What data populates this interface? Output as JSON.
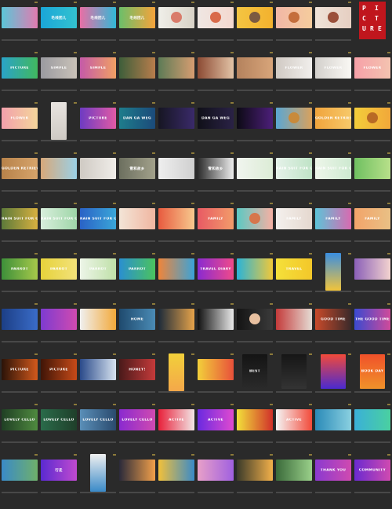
{
  "app": {
    "view": "file-browser-thumbnail-grid"
  },
  "thumbnails": [
    {
      "r": 0,
      "c": 0,
      "bg": "linear-gradient(90deg,#5bc6d8,#e17bb0)",
      "text": ""
    },
    {
      "r": 0,
      "c": 1,
      "bg": "linear-gradient(90deg,#1aa6d8,#33c2cf)",
      "text": "毛线团儿"
    },
    {
      "r": 0,
      "c": 2,
      "bg": "linear-gradient(90deg,#e86fa5,#32b9d6)",
      "text": "毛线团儿"
    },
    {
      "r": 0,
      "c": 3,
      "bg": "linear-gradient(90deg,#6bbf6a,#f6a33b)",
      "text": "毛线团儿"
    },
    {
      "r": 0,
      "c": 4,
      "bg": "linear-gradient(90deg,#f0efe9,#d9d3c7)",
      "text": "",
      "photo": "#d97b6a"
    },
    {
      "r": 0,
      "c": 5,
      "bg": "linear-gradient(90deg,#efe7e3,#f4d8cf)",
      "text": "",
      "photo": "#d96a4a"
    },
    {
      "r": 0,
      "c": 6,
      "bg": "linear-gradient(90deg,#f4c542,#f3b12e)",
      "text": "",
      "photo": "#7b5a41"
    },
    {
      "r": 0,
      "c": 7,
      "bg": "linear-gradient(90deg,#f2b7a6,#f5cc9d)",
      "text": "",
      "photo": "#c46e3c"
    },
    {
      "r": 0,
      "c": 8,
      "bg": "linear-gradient(90deg,#efe3d8,#e6cfc2)",
      "text": "",
      "photo": "#9a4f3a"
    },
    {
      "r": 1,
      "c": 0,
      "bg": "linear-gradient(90deg,#2aa3c8,#41b85f)",
      "text": "PICTURE"
    },
    {
      "r": 1,
      "c": 1,
      "bg": "linear-gradient(90deg,#9a9aa0,#c9c2b8)",
      "text": "SIMPLE"
    },
    {
      "r": 1,
      "c": 2,
      "bg": "linear-gradient(90deg,#c45aa8,#f0a064)",
      "text": "SIMPLE"
    },
    {
      "r": 1,
      "c": 3,
      "bg": "linear-gradient(90deg,#3d5e3a,#b87d4c)",
      "text": ""
    },
    {
      "r": 1,
      "c": 4,
      "bg": "linear-gradient(90deg,#5d7b56,#d79d71)",
      "text": ""
    },
    {
      "r": 1,
      "c": 5,
      "bg": "linear-gradient(90deg,#8c4a33,#e3c4a7)",
      "text": ""
    },
    {
      "r": 1,
      "c": 6,
      "bg": "linear-gradient(90deg,#b4825d,#d8a57a)",
      "text": ""
    },
    {
      "r": 1,
      "c": 7,
      "bg": "linear-gradient(90deg,#d0c9c3,#f1efec)",
      "text": "FLOWER"
    },
    {
      "r": 1,
      "c": 8,
      "bg": "linear-gradient(90deg,#d3d0cc,#faf8f4)",
      "text": "FLOWER"
    },
    {
      "r": 1,
      "c": 9,
      "bg": "linear-gradient(90deg,#f6a0a8,#f4c3b0)",
      "text": "FLOWER"
    },
    {
      "r": 2,
      "c": 0,
      "bg": "linear-gradient(90deg,#f2a0ac,#f4d59b)",
      "text": "FLOWER"
    },
    {
      "r": 2,
      "c": 1,
      "type": "portrait",
      "bg": "linear-gradient(180deg,#e8e4e0,#cfcac4)",
      "text": ""
    },
    {
      "r": 2,
      "c": 2,
      "bg": "linear-gradient(90deg,#6d3bc2,#e25aa5)",
      "text": "PICTURE"
    },
    {
      "r": 2,
      "c": 3,
      "bg": "linear-gradient(90deg,#1e7d8c,#1b4a7a)",
      "text": "DAN GA WEG"
    },
    {
      "r": 2,
      "c": 4,
      "bg": "linear-gradient(90deg,#161622,#3a2a6a)",
      "text": ""
    },
    {
      "r": 2,
      "c": 5,
      "bg": "linear-gradient(90deg,#101018,#2a2246)",
      "text": "DAN GA WEG"
    },
    {
      "r": 2,
      "c": 6,
      "bg": "linear-gradient(90deg,#0c0a14,#4d1f7a)",
      "text": ""
    },
    {
      "r": 2,
      "c": 7,
      "bg": "linear-gradient(90deg,#5aa7d3,#d9a15d)",
      "text": "",
      "photo": "#c88a3b"
    },
    {
      "r": 2,
      "c": 8,
      "bg": "linear-gradient(90deg,#f0a43c,#f7c96a)",
      "text": "GOLDEN RETRIEVER"
    },
    {
      "r": 2,
      "c": 9,
      "bg": "linear-gradient(90deg,#f3cd3a,#f1a83a)",
      "text": "",
      "photo": "#b86a25"
    },
    {
      "r": 3,
      "c": 0,
      "bg": "linear-gradient(90deg,#b7824a,#d6a46b)",
      "text": "GOLDEN RETRIEVER"
    },
    {
      "r": 3,
      "c": 1,
      "bg": "linear-gradient(90deg,#d7a87a,#9bd0e6)",
      "text": ""
    },
    {
      "r": 3,
      "c": 2,
      "bg": "linear-gradient(90deg,#cfcac3,#f0ede9)",
      "text": ""
    },
    {
      "r": 3,
      "c": 3,
      "bg": "linear-gradient(90deg,#6c6f5f,#a2a18b)",
      "text": "雪和故乡"
    },
    {
      "r": 3,
      "c": 4,
      "bg": "linear-gradient(90deg,#efefef,#cfcfcf)",
      "text": ""
    },
    {
      "r": 3,
      "c": 5,
      "bg": "linear-gradient(90deg,#2b2b2b,#ededed)",
      "text": "雪和故乡"
    },
    {
      "r": 3,
      "c": 6,
      "bg": "linear-gradient(90deg,#f1f5ef,#dcecd6)",
      "text": ""
    },
    {
      "r": 3,
      "c": 7,
      "bg": "linear-gradient(90deg,#e6f2ea,#bfe3c6)",
      "text": "RAIN SUIT FOR OUTDOOR KIDS"
    },
    {
      "r": 3,
      "c": 8,
      "bg": "linear-gradient(90deg,#eef6ea,#cde9d0)",
      "text": "RAIN SUIT FOR OUTDOOR KIDS"
    },
    {
      "r": 3,
      "c": 9,
      "bg": "linear-gradient(90deg,#6fc061,#b8e08a)",
      "text": ""
    },
    {
      "r": 4,
      "c": 0,
      "bg": "linear-gradient(90deg,#5c7a3a,#d7b040)",
      "text": "RAIN SUIT FOR OUTDOOR KIDS"
    },
    {
      "r": 4,
      "c": 1,
      "bg": "linear-gradient(90deg,#d8eedc,#9fd6a8)",
      "text": "RAIN SUIT FOR OUTDOOR KIDS"
    },
    {
      "r": 4,
      "c": 2,
      "bg": "linear-gradient(90deg,#2a62c6,#3aa6d8)",
      "text": "RAIN SUIT FOR OUTDOOR KIDS"
    },
    {
      "r": 4,
      "c": 3,
      "bg": "linear-gradient(90deg,#f3e5d7,#f0b5a0)",
      "text": ""
    },
    {
      "r": 4,
      "c": 4,
      "bg": "linear-gradient(90deg,#e85b3f,#f7c98e)",
      "text": ""
    },
    {
      "r": 4,
      "c": 5,
      "bg": "linear-gradient(90deg,#e85a64,#f29c6a)",
      "text": "FAMILY"
    },
    {
      "r": 4,
      "c": 6,
      "bg": "linear-gradient(90deg,#5bc9c3,#f6b0a3)",
      "text": "",
      "photo": "#d6764c"
    },
    {
      "r": 4,
      "c": 7,
      "bg": "linear-gradient(90deg,#f4f0ed,#e5d8cf)",
      "text": "FAMILY"
    },
    {
      "r": 4,
      "c": 8,
      "bg": "linear-gradient(90deg,#5cc4d8,#d86ab0)",
      "text": "FAMILY"
    },
    {
      "r": 4,
      "c": 9,
      "bg": "linear-gradient(90deg,#f2a46a,#e9c085)",
      "text": "FAMILY"
    },
    {
      "r": 5,
      "c": 0,
      "bg": "linear-gradient(90deg,#3d8f3a,#a6c94a)",
      "text": "PARROT"
    },
    {
      "r": 5,
      "c": 1,
      "bg": "linear-gradient(90deg,#e6d23b,#f3e27a)",
      "text": "PARROT"
    },
    {
      "r": 5,
      "c": 2,
      "bg": "linear-gradient(90deg,#edf5e8,#bfe0a8)",
      "text": "PARROT"
    },
    {
      "r": 5,
      "c": 3,
      "bg": "linear-gradient(90deg,#2a8fd0,#4bc35e)",
      "text": "PARROT"
    },
    {
      "r": 5,
      "c": 4,
      "bg": "linear-gradient(90deg,#f0853a,#3aa3d8)",
      "text": ""
    },
    {
      "r": 5,
      "c": 5,
      "bg": "linear-gradient(90deg,#8a2ad0,#f04a8a)",
      "text": "TRAVEL DIARY"
    },
    {
      "r": 5,
      "c": 6,
      "bg": "linear-gradient(90deg,#2ab3d8,#f0c83a)",
      "text": ""
    },
    {
      "r": 5,
      "c": 7,
      "bg": "linear-gradient(90deg,#f5e03a,#f3c72a)",
      "text": "TRAVEL"
    },
    {
      "r": 5,
      "c": 8,
      "type": "portrait",
      "bg": "linear-gradient(180deg,#3a8ee0,#f2c43a)",
      "text": ""
    },
    {
      "r": 5,
      "c": 9,
      "bg": "linear-gradient(90deg,#8a5fb8,#f3d3cf)",
      "text": ""
    },
    {
      "r": 6,
      "c": 0,
      "bg": "linear-gradient(90deg,#1c3f86,#3a6cc8)",
      "text": ""
    },
    {
      "r": 6,
      "c": 1,
      "bg": "linear-gradient(90deg,#7d3bd0,#d04ab0)",
      "text": ""
    },
    {
      "r": 6,
      "c": 2,
      "bg": "linear-gradient(90deg,#f0f0f0,#f2a93a)",
      "text": ""
    },
    {
      "r": 6,
      "c": 3,
      "bg": "linear-gradient(90deg,#1f4a6e,#4a8bb5)",
      "text": "HOME"
    },
    {
      "r": 6,
      "c": 4,
      "bg": "linear-gradient(90deg,#1d2b3a,#e6a34a)",
      "text": ""
    },
    {
      "r": 6,
      "c": 5,
      "bg": "linear-gradient(90deg,#111111,#e9e9e9)",
      "text": ""
    },
    {
      "r": 6,
      "c": 6,
      "bg": "linear-gradient(90deg,#141414,#3a3a3a)",
      "text": "",
      "photo": "#e8c0a0"
    },
    {
      "r": 6,
      "c": 7,
      "bg": "linear-gradient(90deg,#c43a3a,#e5dcd4)",
      "text": ""
    },
    {
      "r": 6,
      "c": 8,
      "bg": "linear-gradient(90deg,#c94a2a,#3a2a2a)",
      "text": "GOOD TIME"
    },
    {
      "r": 6,
      "c": 9,
      "bg": "linear-gradient(90deg,#3a4ad0,#d04a9a)",
      "text": "THE GOOD TIME"
    },
    {
      "r": 7,
      "c": 0,
      "bg": "linear-gradient(90deg,#2b1308,#d2591c)",
      "text": "PICTURE"
    },
    {
      "r": 7,
      "c": 1,
      "bg": "linear-gradient(90deg,#401507,#c64a18)",
      "text": "PICTURE"
    },
    {
      "r": 7,
      "c": 2,
      "bg": "linear-gradient(90deg,#2a4a8a,#d7e3f0)",
      "text": ""
    },
    {
      "r": 7,
      "c": 3,
      "bg": "linear-gradient(90deg,#4a1a1a,#c43a3a)",
      "text": "HONEY!"
    },
    {
      "r": 7,
      "c": 4,
      "type": "portrait",
      "bg": "linear-gradient(180deg,#f2d03a,#f4a84a)",
      "text": ""
    },
    {
      "r": 7,
      "c": 5,
      "bg": "linear-gradient(90deg,#f2d03a,#e8503a)",
      "text": ""
    },
    {
      "r": 7,
      "c": 6,
      "type": "poster",
      "bg": "linear-gradient(180deg,#141414,#2a2a2a)",
      "text": "BEST"
    },
    {
      "r": 7,
      "c": 7,
      "type": "poster",
      "bg": "linear-gradient(180deg,#161616,#333333)",
      "text": ""
    },
    {
      "r": 7,
      "c": 8,
      "type": "poster",
      "bg": "linear-gradient(180deg,#f24a3a,#4a2ad0)",
      "text": ""
    },
    {
      "r": 7,
      "c": 9,
      "type": "poster",
      "bg": "linear-gradient(180deg,#f0512a,#f0922a)",
      "text": "BOOK DAY"
    },
    {
      "r": 8,
      "c": 0,
      "bg": "linear-gradient(90deg,#1f3f24,#4f8a3f)",
      "text": "LOVELY CELLO"
    },
    {
      "r": 8,
      "c": 1,
      "bg": "linear-gradient(90deg,#2a6b4a,#1f3f2a)",
      "text": "LOVELY CELLO"
    },
    {
      "r": 8,
      "c": 2,
      "bg": "linear-gradient(90deg,#5a8fb8,#2a4a6e)",
      "text": "LOVELY CELLO"
    },
    {
      "r": 8,
      "c": 3,
      "bg": "linear-gradient(90deg,#8a2ad0,#d04ab0)",
      "text": "LOVELY CELLO"
    },
    {
      "r": 8,
      "c": 4,
      "bg": "linear-gradient(90deg,#e8203a,#f2e6e6)",
      "text": "ACTIVE"
    },
    {
      "r": 8,
      "c": 5,
      "bg": "linear-gradient(90deg,#6a2ae0,#e04ad0)",
      "text": "ACTIVE"
    },
    {
      "r": 8,
      "c": 6,
      "bg": "linear-gradient(90deg,#f2e03a,#d0302a)",
      "text": ""
    },
    {
      "r": 8,
      "c": 7,
      "bg": "linear-gradient(90deg,#f5f5f5,#f24a3a)",
      "text": "ACTIVE"
    },
    {
      "r": 8,
      "c": 8,
      "bg": "linear-gradient(90deg,#2a8ab8,#8ad0e0)",
      "text": ""
    },
    {
      "r": 8,
      "c": 9,
      "bg": "linear-gradient(90deg,#3ab0d8,#4ad0a0)",
      "text": ""
    },
    {
      "r": 9,
      "c": 0,
      "bg": "linear-gradient(90deg,#3a8ac8,#6fb06a)",
      "text": ""
    },
    {
      "r": 9,
      "c": 1,
      "bg": "linear-gradient(90deg,#5a2ad0,#c04ad0)",
      "text": "行走"
    },
    {
      "r": 9,
      "c": 2,
      "type": "portrait",
      "bg": "linear-gradient(180deg,#f0f0f0,#3a8ac8)",
      "text": ""
    },
    {
      "r": 9,
      "c": 3,
      "bg": "linear-gradient(90deg,#2a2a3a,#f2a04a)",
      "text": ""
    },
    {
      "r": 9,
      "c": 4,
      "bg": "linear-gradient(90deg,#f2c03a,#3a8ac8)",
      "text": ""
    },
    {
      "r": 9,
      "c": 5,
      "bg": "linear-gradient(90deg,#e8a0c8,#a060e0)",
      "text": ""
    },
    {
      "r": 9,
      "c": 6,
      "bg": "linear-gradient(90deg,#3a3a2a,#f2b04a)",
      "text": ""
    },
    {
      "r": 9,
      "c": 7,
      "bg": "linear-gradient(90deg,#3a6a3a,#9ad08a)",
      "text": ""
    },
    {
      "r": 9,
      "c": 8,
      "bg": "linear-gradient(90deg,#8a3ad0,#d04ab0)",
      "text": "THANK YOU"
    },
    {
      "r": 9,
      "c": 9,
      "bg": "linear-gradient(90deg,#6a2ad0,#d04ab0)",
      "text": "COMMUNITY"
    }
  ],
  "logo": {
    "letters": [
      "P",
      "I",
      "C",
      "T",
      "U",
      "R",
      "E"
    ],
    "color": "#c0161d"
  }
}
